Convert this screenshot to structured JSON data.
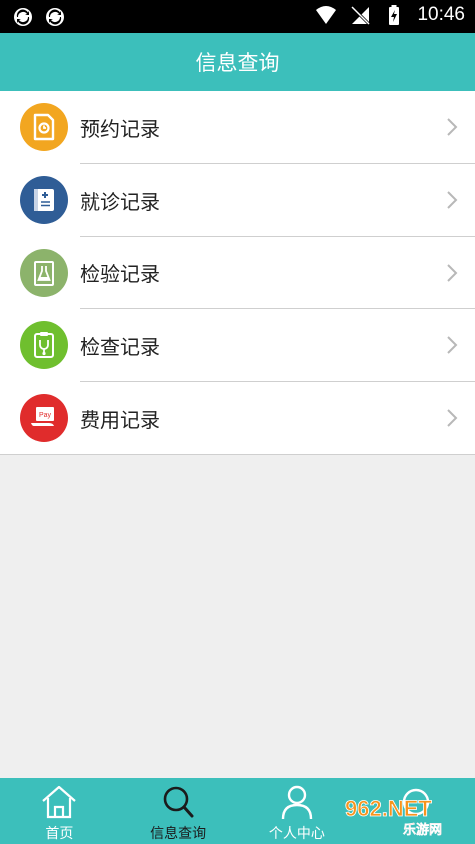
{
  "status_bar": {
    "time": "10:46"
  },
  "header": {
    "title": "信息查询"
  },
  "records": [
    {
      "label": "预约记录",
      "icon": "appointment-icon",
      "color": "#f2a620"
    },
    {
      "label": "就诊记录",
      "icon": "clinic-visit-icon",
      "color": "#2f5d96"
    },
    {
      "label": "检验记录",
      "icon": "lab-test-icon",
      "color": "#8cb36b"
    },
    {
      "label": "检查记录",
      "icon": "examination-icon",
      "color": "#6fbf2e"
    },
    {
      "label": "费用记录",
      "icon": "payment-icon",
      "color": "#e02c2c"
    }
  ],
  "tabbar": {
    "items": [
      {
        "label": "首页",
        "icon": "home-icon",
        "active": false
      },
      {
        "label": "信息查询",
        "icon": "search-icon",
        "active": true
      },
      {
        "label": "个人中心",
        "icon": "user-icon",
        "active": false
      },
      {
        "label": "",
        "icon": "more-icon",
        "active": false
      }
    ]
  },
  "watermark": {
    "text": "962.NET",
    "subtext": "乐游网"
  },
  "colors": {
    "theme": "#3cbfbb",
    "active_tab_text": "#1b1b1b"
  }
}
